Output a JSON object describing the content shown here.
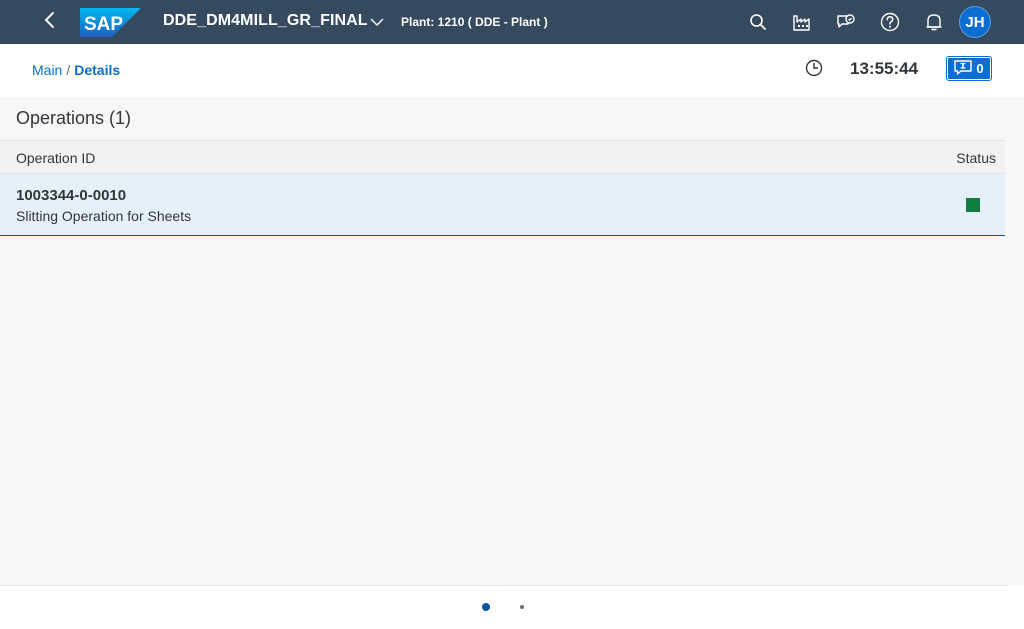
{
  "shell": {
    "logo_text": "SAP",
    "app_title": "DDE_DM4MILL_GR_FINAL",
    "plant": "Plant: 1210 ( DDE - Plant )",
    "avatar_initials": "JH",
    "icons": [
      "search-icon",
      "plant-icon",
      "feedback-icon",
      "help-icon",
      "notification-icon"
    ],
    "bg_color": "#354a5f"
  },
  "header": {
    "breadcrumb_main": "Main",
    "breadcrumb_sep": "/",
    "breadcrumb_current": "Details",
    "clock_time": "13:55:44",
    "message_count": "0"
  },
  "operations": {
    "title": "Operations (1)",
    "columns": {
      "id": "Operation ID",
      "status": "Status"
    },
    "rows": [
      {
        "id": "1003344-0-0010",
        "description": "Slitting Operation for Sheets",
        "status_color": "#107e3e"
      }
    ]
  },
  "pagination": {
    "pages": 2,
    "current": 1
  }
}
